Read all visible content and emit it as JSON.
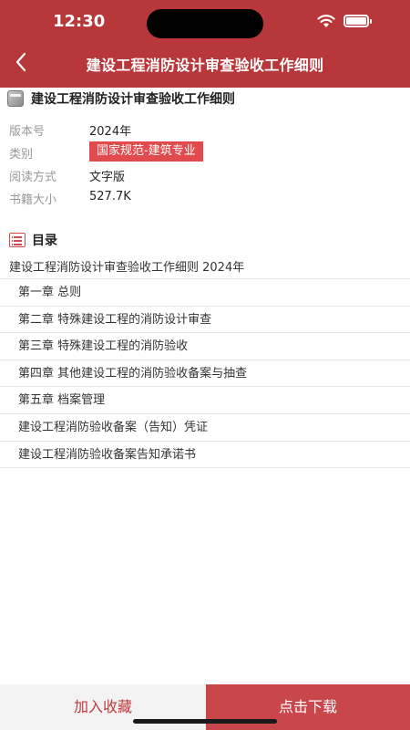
{
  "status_bar": {
    "time": "12:30"
  },
  "header": {
    "title": "建设工程消防设计审查验收工作细则"
  },
  "book": {
    "title": "建设工程消防设计审查验收工作细则",
    "meta": [
      {
        "label": "版本号",
        "value": "2024年"
      },
      {
        "label": "类别",
        "value": "国家规范-建筑专业"
      },
      {
        "label": "阅读方式",
        "value": "文字版"
      },
      {
        "label": "书籍大小",
        "value": "527.7K"
      }
    ]
  },
  "toc": {
    "label": "目录",
    "book_line": "建设工程消防设计审查验收工作细则 2024年",
    "items": [
      "第一章 总则",
      "第二章 特殊建设工程的消防设计审查",
      "第三章 特殊建设工程的消防验收",
      "第四章 其他建设工程的消防验收备案与抽查",
      "第五章 档案管理",
      "建设工程消防验收备案（告知）凭证",
      "建设工程消防验收备案告知承诺书"
    ]
  },
  "actions": {
    "favorite_label": "加入收藏",
    "download_label": "点击下载"
  },
  "colors": {
    "header": "#b8373a",
    "tag": "#e24b4d",
    "download": "#c9474a",
    "favorite_text": "#c0393c"
  }
}
